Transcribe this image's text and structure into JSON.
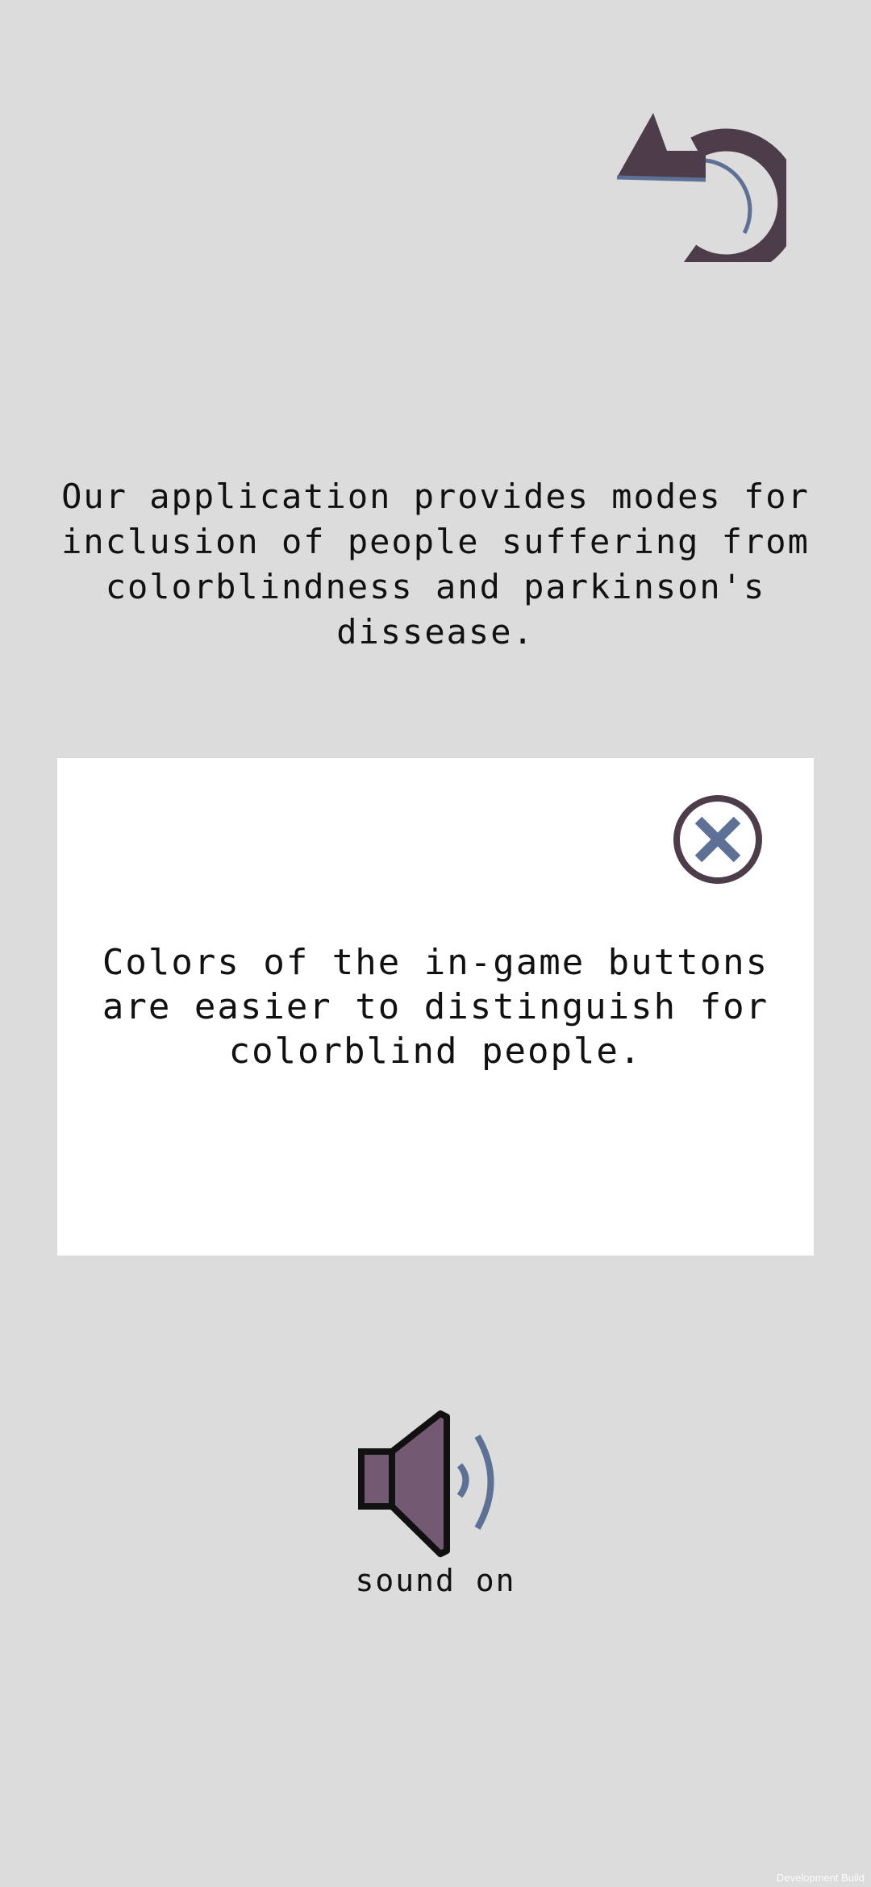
{
  "header": {
    "back_icon": "undo-arrow-icon"
  },
  "intro": {
    "text": "Our application provides modes for\ninclusion of people suffering from\ncolorblindness and parkinson's\ndissease."
  },
  "info_panel": {
    "close_icon": "close-x-icon",
    "text": "Colors of the in-game buttons\nare easier to distinguish for\ncolorblind people."
  },
  "sound": {
    "icon": "speaker-icon",
    "label": "sound on"
  },
  "footer": {
    "dev_build": "Development Build"
  },
  "colors": {
    "background": "#dcdcdc",
    "panel": "#ffffff",
    "icon_dark": "#4d3d4a",
    "icon_accent": "#5d7096",
    "speaker_fill": "#735a72",
    "text": "#111111"
  }
}
